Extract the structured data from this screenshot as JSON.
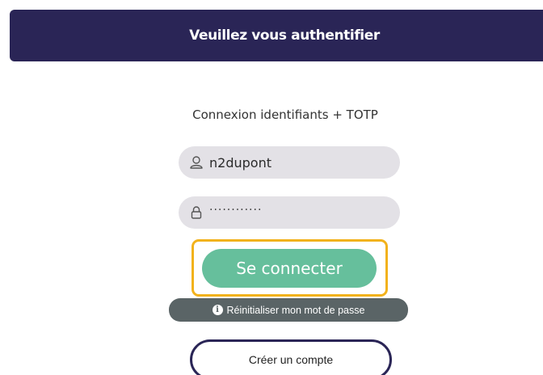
{
  "header": {
    "title": "Veuillez vous authentifier"
  },
  "login": {
    "subtitle": "Connexion identifiants + TOTP",
    "username_value": "n2dupont",
    "username_icon": "user-icon",
    "password_value": "············",
    "password_icon": "lock-icon",
    "connect_label": "Se connecter",
    "reset_label": "Réinitialiser mon mot de passe",
    "reset_icon": "info-icon",
    "create_label": "Créer un compte"
  },
  "colors": {
    "header_bg": "#2a2556",
    "connect_bg": "#66bf9c",
    "highlight_border": "#f2b21c",
    "reset_bg": "#5a6466",
    "field_bg": "#e3e1e6"
  }
}
